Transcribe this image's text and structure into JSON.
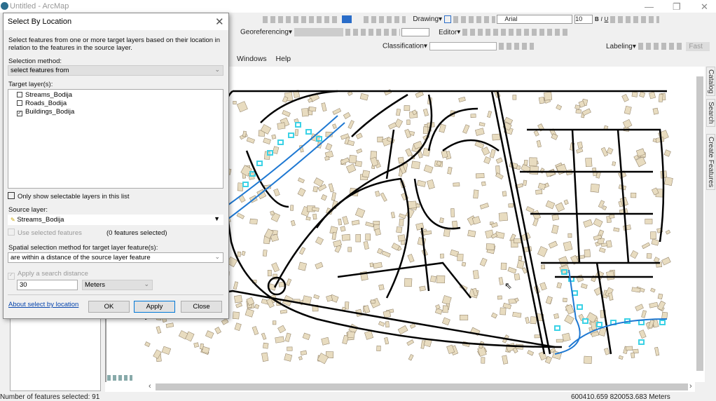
{
  "app": {
    "title": "Untitled - ArcMap",
    "minimize": "—",
    "restore": "❐",
    "close": "✕"
  },
  "toolbars": {
    "drawing": "Drawing",
    "font": "Arial",
    "font_size": "10",
    "bold": "B",
    "italic": "I",
    "underline": "U",
    "georeferencing": "Georeferencing",
    "editor": "Editor",
    "classification": "Classification",
    "labeling": "Labeling",
    "fast": "Fast"
  },
  "menu": {
    "items": [
      "Windows",
      "Help"
    ]
  },
  "side_tabs": [
    "Catalog",
    "Search",
    "Create Features"
  ],
  "status": {
    "selected": "Number of features selected: 91",
    "coords": "600410.659  820053.683 Meters"
  },
  "dialog": {
    "title": "Select By Location",
    "close": "✕",
    "description": "Select features from one or more target layers based on their location in relation to the features in the source layer.",
    "selection_method_label": "Selection method:",
    "selection_method": "select features from",
    "target_layers_label": "Target layer(s):",
    "target_layers": [
      {
        "name": "Streams_Bodija",
        "checked": false
      },
      {
        "name": "Roads_Bodija",
        "checked": false
      },
      {
        "name": "Buildings_Bodija",
        "checked": true
      }
    ],
    "only_selectable": "Only show selectable layers in this list",
    "source_layer_label": "Source layer:",
    "source_layer": "Streams_Bodija",
    "use_selected": "Use selected features",
    "features_selected": "(0 features selected)",
    "spatial_method_label": "Spatial selection method for target layer feature(s):",
    "spatial_method": "are within a distance of the source layer feature",
    "apply_distance": "Apply a search distance",
    "distance": "30",
    "units": "Meters",
    "about_link": "About select by location",
    "ok": "OK",
    "apply": "Apply",
    "close_btn": "Close"
  },
  "colors": {
    "road": "#000000",
    "stream": "#1e78d2",
    "building": "#e8dcc0",
    "selected": "#3cd2e6"
  }
}
